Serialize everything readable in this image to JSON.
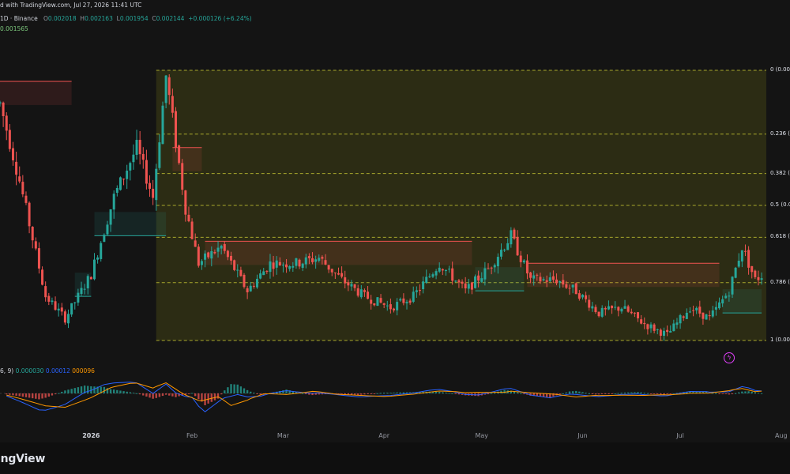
{
  "header": {
    "published": "d with TradingView.com, Jul 27, 2026 11:41 UTC",
    "symbol": "1D · Binance",
    "ohlc": {
      "o_label": "O",
      "o": "0.002018",
      "h_label": "H",
      "h": "0.002163",
      "l_label": "L",
      "l": "0.001954",
      "c_label": "C",
      "c": "0.002144",
      "change": "+0.000126 (+6.24%)"
    },
    "indicator_value": "0.001565"
  },
  "macd_header": {
    "params": "6, 9)",
    "hist": "0.000030",
    "macd": "0.00012",
    "signal": "000096"
  },
  "fib_labels": [
    {
      "label": "0 (0.00",
      "level": 0
    },
    {
      "label": "0.236 (0",
      "level": 0.236
    },
    {
      "label": "0.382 (0",
      "level": 0.382
    },
    {
      "label": "0.5 (0.0",
      "level": 0.5
    },
    {
      "label": "0.618 (0",
      "level": 0.618
    },
    {
      "label": "0.786 (0",
      "level": 0.786
    },
    {
      "label": "1 (0.00",
      "level": 1
    }
  ],
  "xaxis": [
    {
      "label": "2026",
      "bold": true
    },
    {
      "label": "Feb"
    },
    {
      "label": "Mar"
    },
    {
      "label": "Apr"
    },
    {
      "label": "May"
    },
    {
      "label": "Jun"
    },
    {
      "label": "Jul"
    },
    {
      "label": "Aug"
    }
  ],
  "footer": {
    "brand": "ingView"
  },
  "colors": {
    "up": "#26a69a",
    "down": "#ef5350",
    "fib": "#c8c832",
    "macd": "#2962ff",
    "signal": "#ff9800",
    "bg": "#141414"
  },
  "chart_data": {
    "type": "candlestick",
    "timeframe": "1D",
    "exchange": "Binance",
    "fib_range": {
      "level_0": 0.004,
      "level_1": 0.00155
    },
    "anchors": [
      [
        "2025-12-04",
        0.0037
      ],
      [
        "2025-12-10",
        0.003
      ],
      [
        "2025-12-18",
        0.00195
      ],
      [
        "2025-12-24",
        0.00175
      ],
      [
        "2026-01-01",
        0.00215
      ],
      [
        "2026-01-08",
        0.00285
      ],
      [
        "2026-01-15",
        0.0033
      ],
      [
        "2026-01-20",
        0.00285
      ],
      [
        "2026-01-24",
        0.00395
      ],
      [
        "2026-01-30",
        0.00275
      ],
      [
        "2026-02-03",
        0.00225
      ],
      [
        "2026-02-10",
        0.0024
      ],
      [
        "2026-02-18",
        0.002
      ],
      [
        "2026-02-25",
        0.00225
      ],
      [
        "2026-03-05",
        0.00225
      ],
      [
        "2026-03-12",
        0.0023
      ],
      [
        "2026-03-19",
        0.0021
      ],
      [
        "2026-03-26",
        0.00195
      ],
      [
        "2026-04-03",
        0.00185
      ],
      [
        "2026-04-10",
        0.00195
      ],
      [
        "2026-04-18",
        0.00225
      ],
      [
        "2026-04-26",
        0.002
      ],
      [
        "2026-05-03",
        0.0022
      ],
      [
        "2026-05-10",
        0.0025
      ],
      [
        "2026-05-16",
        0.0021
      ],
      [
        "2026-05-24",
        0.0021
      ],
      [
        "2026-05-30",
        0.002
      ],
      [
        "2026-06-06",
        0.0018
      ],
      [
        "2026-06-13",
        0.00185
      ],
      [
        "2026-06-20",
        0.0017
      ],
      [
        "2026-06-27",
        0.0016
      ],
      [
        "2026-07-04",
        0.00185
      ],
      [
        "2026-07-10",
        0.00175
      ],
      [
        "2026-07-16",
        0.002
      ],
      [
        "2026-07-20",
        0.0024
      ],
      [
        "2026-07-24",
        0.0021
      ],
      [
        "2026-07-26",
        0.00214
      ]
    ],
    "supertrend": [
      {
        "from": "2025-12-04",
        "to": "2025-12-26",
        "value": 0.0039,
        "direction": "down"
      },
      {
        "from": "2025-12-27",
        "to": "2026-01-01",
        "value": 0.00195,
        "direction": "up"
      },
      {
        "from": "2026-01-02",
        "to": "2026-01-24",
        "value": 0.0025,
        "direction": "up"
      },
      {
        "from": "2026-01-26",
        "to": "2026-02-04",
        "value": 0.0033,
        "direction": "down"
      },
      {
        "from": "2026-02-05",
        "to": "2026-04-28",
        "value": 0.00245,
        "direction": "down"
      },
      {
        "from": "2026-04-29",
        "to": "2026-05-14",
        "value": 0.002,
        "direction": "up"
      },
      {
        "from": "2026-05-15",
        "to": "2026-07-13",
        "value": 0.00225,
        "direction": "down"
      },
      {
        "from": "2026-07-14",
        "to": "2026-07-26",
        "value": 0.0018,
        "direction": "up"
      }
    ]
  }
}
